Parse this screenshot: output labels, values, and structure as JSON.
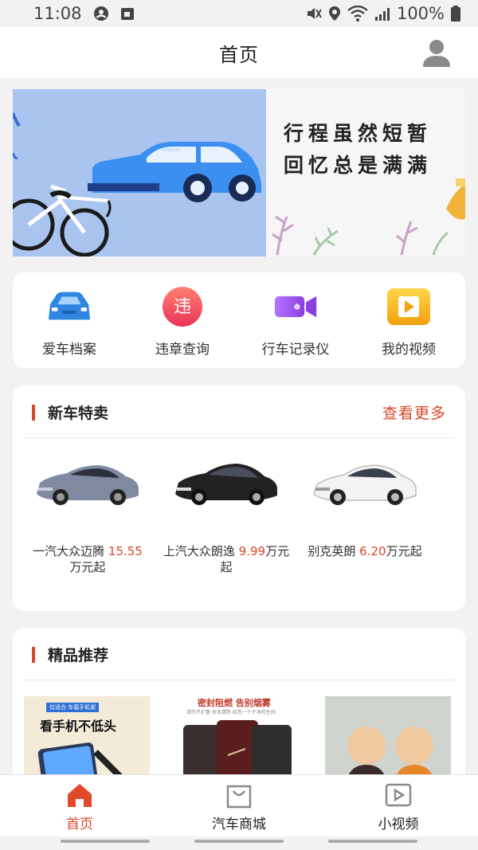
{
  "status_bar": {
    "time": "11:08",
    "battery": "100%"
  },
  "header": {
    "title": "首页"
  },
  "banner": {
    "line1": "行程虽然短暂",
    "line2": "回忆总是满满"
  },
  "quick_entries": [
    {
      "label": "爱车档案",
      "icon": "car-archive-icon",
      "color": "#3a8ee6"
    },
    {
      "label": "违章查询",
      "icon": "violation-icon",
      "glyph": "违",
      "color": "#ef4a4a"
    },
    {
      "label": "行车记录仪",
      "icon": "dashcam-icon",
      "color": "#a456e8"
    },
    {
      "label": "我的视频",
      "icon": "video-icon",
      "color": "#f6b21d"
    }
  ],
  "new_cars": {
    "title": "新车特卖",
    "more": "查看更多",
    "items": [
      {
        "name": "一汽大众迈腾 ",
        "price": "15.55",
        "unit": "万元起",
        "car_color": "#7f8aa0"
      },
      {
        "name": "上汽大众朗逸 ",
        "price": "9.99",
        "unit": "万元起",
        "car_color": "#222222"
      },
      {
        "name": "别克英朗 ",
        "price": "6.20",
        "unit": "万元起",
        "car_color": "#f3f3f3"
      }
    ]
  },
  "boutique": {
    "title": "精品推荐",
    "products": [
      {
        "caption": "看手机不低头",
        "tag": "仅适合·车载手机架"
      },
      {
        "caption": "密封阻燃 告别烟雾",
        "tag": "请勿不扩散 有效清除 给您一个干净的空间"
      },
      {
        "caption": ""
      }
    ]
  },
  "bottom_nav": [
    {
      "label": "首页",
      "icon": "home-icon",
      "active": true
    },
    {
      "label": "汽车商城",
      "icon": "shopping-bag-icon",
      "active": false
    },
    {
      "label": "小视频",
      "icon": "play-video-icon",
      "active": false
    }
  ],
  "colors": {
    "accent": "#d9482a",
    "banner_blue": "#a9c4ef"
  }
}
